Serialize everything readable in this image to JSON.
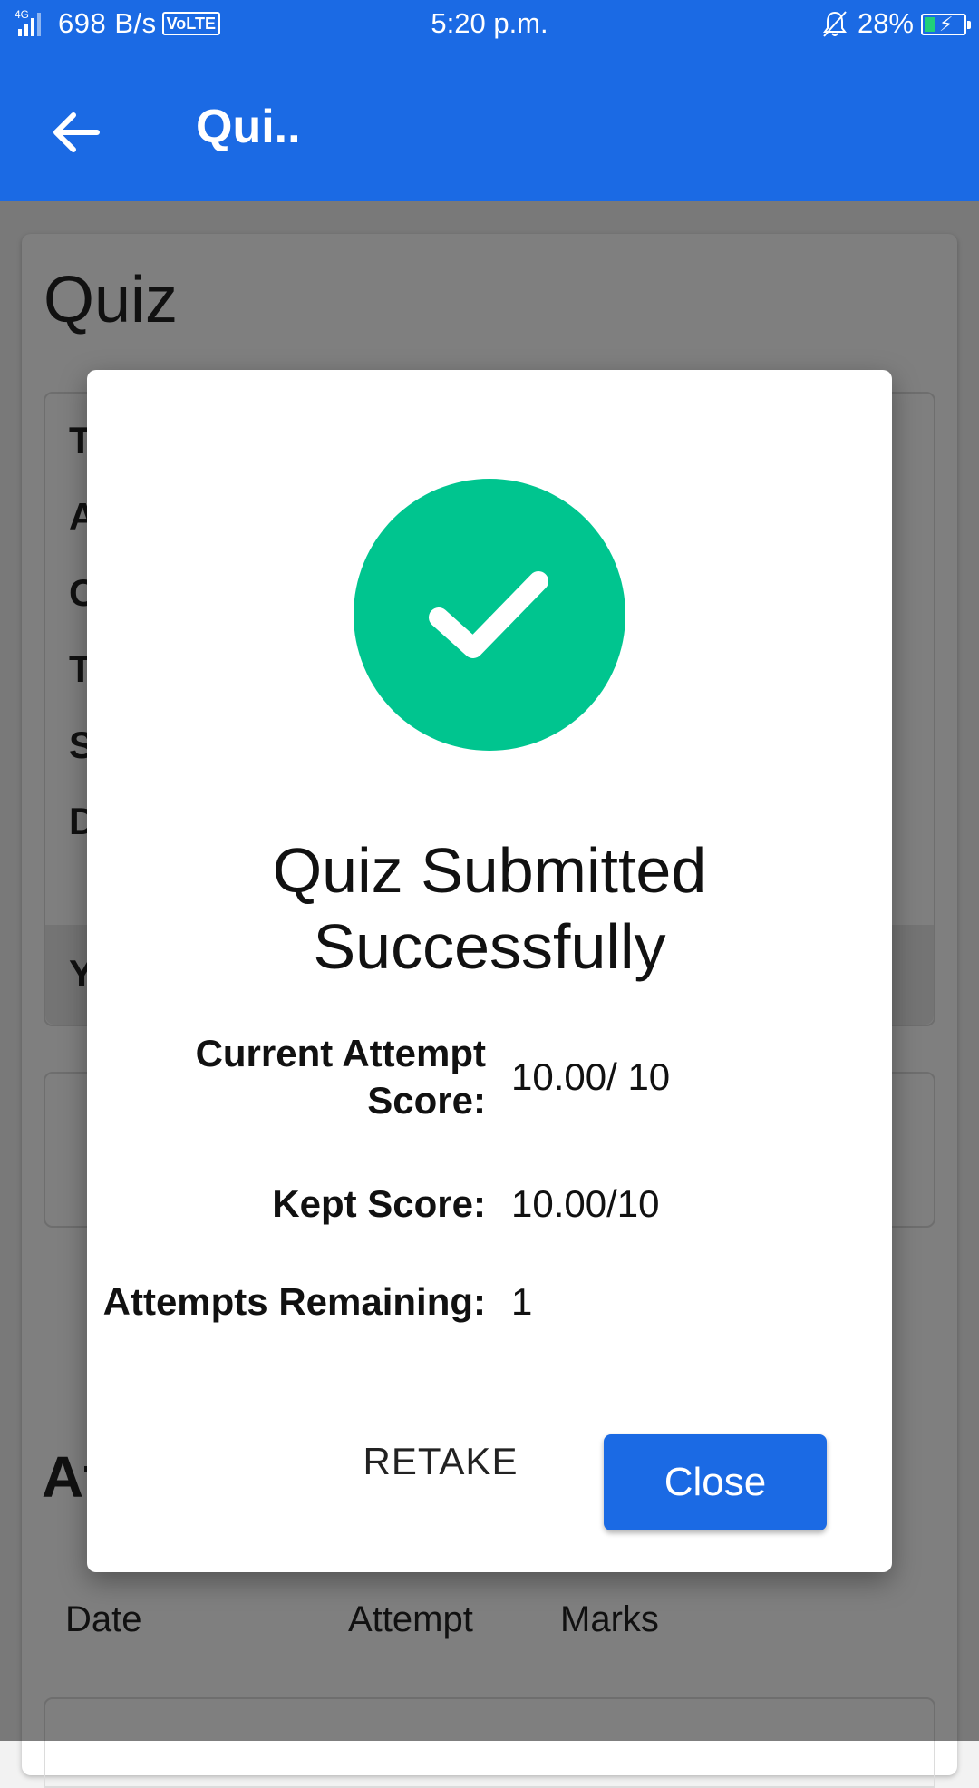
{
  "status_bar": {
    "network": "4G",
    "speed": "698 B/s",
    "volte": "VoLTE",
    "time": "5:20 p.m.",
    "battery_percent": "28%",
    "battery_level": 0.28
  },
  "app_bar": {
    "title": "Qui..",
    "back_icon": "arrow-left-icon"
  },
  "background_page": {
    "title": "Quiz",
    "info_row_initials": [
      "T",
      "A",
      "C",
      "T",
      "S",
      "D"
    ],
    "highlight_row_initial": "Y",
    "section_title_partial": "At",
    "table_headers": [
      "Date",
      "Attempt",
      "Marks"
    ]
  },
  "dialog": {
    "icon": "check-circle-icon",
    "title_line1": "Quiz Submitted",
    "title_line2": "Successfully",
    "current_attempt_label_line1": "Current Attempt",
    "current_attempt_label_line2": "Score:",
    "current_attempt_value": "10.00/ 10",
    "kept_score_label": "Kept Score:",
    "kept_score_value": "10.00/10",
    "attempts_remaining_label": "Attempts Remaining:",
    "attempts_remaining_value": "1",
    "retake_label": "RETAKE",
    "close_label": "Close"
  },
  "colors": {
    "primary": "#1b6ae4",
    "success": "#00c58f",
    "scrim": "rgba(0,0,0,0.5)"
  }
}
